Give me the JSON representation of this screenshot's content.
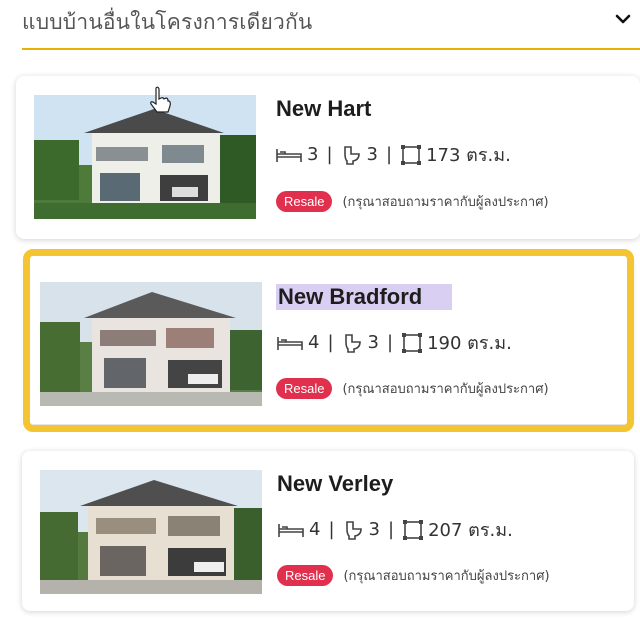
{
  "section": {
    "title": "แบบบ้านอื่นในโครงการเดียวกัน",
    "accent_color": "#e8b100"
  },
  "listings": [
    {
      "name": "New Hart",
      "bedrooms": "3",
      "bathrooms": "3",
      "area": "173 ตร.ม.",
      "badge": "Resale",
      "note": "(กรุณาสอบถามราคากับผู้ลงประกาศ)",
      "highlighted": false
    },
    {
      "name": "New Bradford",
      "bedrooms": "4",
      "bathrooms": "3",
      "area": "190 ตร.ม.",
      "badge": "Resale",
      "note": "(กรุณาสอบถามราคากับผู้ลงประกาศ)",
      "highlighted": true
    },
    {
      "name": "New Verley",
      "bedrooms": "4",
      "bathrooms": "3",
      "area": "207 ตร.ม.",
      "badge": "Resale",
      "note": "(กรุณาสอบถามราคากับผู้ลงประกาศ)",
      "highlighted": false
    }
  ],
  "spec_separator": "|",
  "icons": {
    "bed": "bed-icon",
    "bath": "toilet-icon",
    "area": "area-icon",
    "toggle": "chevron-down-icon"
  },
  "colors": {
    "badge": "#e0304e",
    "highlight_frame": "#f5c531",
    "name_highlight": "#d9cff2"
  }
}
